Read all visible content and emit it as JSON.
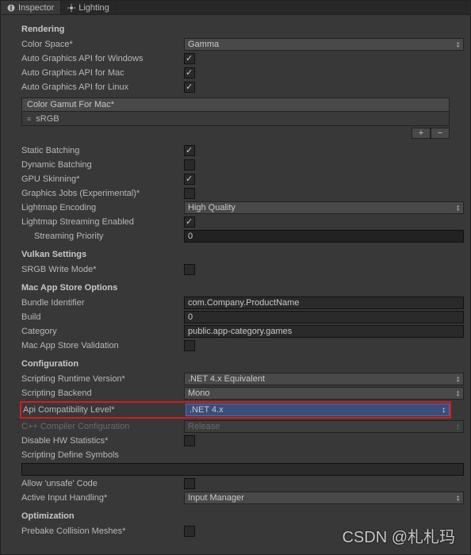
{
  "tabs": {
    "inspector": "Inspector",
    "lighting": "Lighting"
  },
  "sections": {
    "rendering": "Rendering",
    "vulkan": "Vulkan Settings",
    "macstore": "Mac App Store Options",
    "configuration": "Configuration",
    "optimization": "Optimization"
  },
  "rendering": {
    "colorSpace": {
      "label": "Color Space*",
      "value": "Gamma"
    },
    "autoGfxWin": {
      "label": "Auto Graphics API for Windows"
    },
    "autoGfxMac": {
      "label": "Auto Graphics API for Mac"
    },
    "autoGfxLinux": {
      "label": "Auto Graphics API for Linux"
    },
    "colorGamutHeader": "Color Gamut For Mac*",
    "colorGamutItem": "sRGB",
    "staticBatching": {
      "label": "Static Batching"
    },
    "dynamicBatching": {
      "label": "Dynamic Batching"
    },
    "gpuSkinning": {
      "label": "GPU Skinning*"
    },
    "graphicsJobs": {
      "label": "Graphics Jobs (Experimental)*"
    },
    "lightmapEncoding": {
      "label": "Lightmap Encoding",
      "value": "High Quality"
    },
    "lightmapStreaming": {
      "label": "Lightmap Streaming Enabled"
    },
    "streamingPriority": {
      "label": "Streaming Priority",
      "value": "0"
    }
  },
  "vulkan": {
    "srgbWrite": {
      "label": "SRGB Write Mode*"
    }
  },
  "macstore": {
    "bundleId": {
      "label": "Bundle Identifier",
      "value": "com.Company.ProductName"
    },
    "build": {
      "label": "Build",
      "value": "0"
    },
    "category": {
      "label": "Category",
      "value": "public.app-category.games"
    },
    "validation": {
      "label": "Mac App Store Validation"
    }
  },
  "config": {
    "scriptingRuntime": {
      "label": "Scripting Runtime Version*",
      "value": ".NET 4.x Equivalent"
    },
    "scriptingBackend": {
      "label": "Scripting Backend",
      "value": "Mono"
    },
    "apiCompat": {
      "label": "Api Compatibility Level*",
      "value": ".NET 4.x"
    },
    "cppConfig": {
      "label": "C++ Compiler Configuration",
      "value": "Release"
    },
    "disableHwStats": {
      "label": "Disable HW Statistics*"
    },
    "defineSymbols": {
      "label": "Scripting Define Symbols"
    },
    "allowUnsafe": {
      "label": "Allow 'unsafe' Code"
    },
    "activeInput": {
      "label": "Active Input Handling*",
      "value": "Input Manager"
    }
  },
  "optimization": {
    "prebake": {
      "label": "Prebake Collision Meshes*"
    }
  },
  "watermark": "CSDN @札札玛"
}
